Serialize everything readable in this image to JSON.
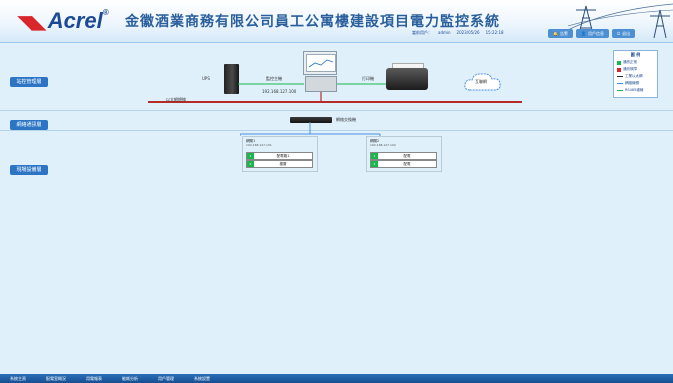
{
  "header": {
    "logo_text": "Acrel",
    "logo_mark": "◥◣",
    "logo_reg": "®",
    "title": "金徽酒業商務有限公司員工公寓樓建設項目電力監控系統",
    "info": [
      "當前用戶：",
      "admin",
      "2023/05/26",
      "15:22:18"
    ],
    "buttons": [
      {
        "label": "告警",
        "icon": "bell-icon"
      },
      {
        "label": "用戶信息",
        "icon": "user-icon"
      },
      {
        "label": "退出",
        "icon": "power-icon"
      }
    ]
  },
  "sidebar": {
    "items": [
      {
        "label": "站控管理層"
      },
      {
        "label": "網絡通訊層"
      },
      {
        "label": "現場設備層"
      }
    ]
  },
  "topology": {
    "server_label": "UPS",
    "bus_label": "以太網總線",
    "pc_label_1": "監控主機",
    "pc_label_2": "192.168.127.100",
    "printer_label": "打印機",
    "cloud_label": "互聯網",
    "switch_label": "網絡交換機"
  },
  "legend": {
    "title": "圖 例",
    "items": [
      {
        "label": "通訊正常",
        "color": "#18b84a",
        "kind": "box"
      },
      {
        "label": "通訊故障",
        "color": "#d8262a",
        "kind": "box"
      },
      {
        "label": "工業以太網",
        "color": "#2b2b2b",
        "kind": "line"
      },
      {
        "label": "網絡線纜",
        "color": "#4a8fe0",
        "kind": "line"
      },
      {
        "label": "RS485總線",
        "color": "#18b84a",
        "kind": "line"
      }
    ]
  },
  "panels": [
    {
      "name": "網關1",
      "ip": "192.168.127.101",
      "rows": [
        {
          "ind": "1",
          "name": "配電箱1"
        },
        {
          "ind": "2",
          "name": "樓層"
        }
      ]
    },
    {
      "name": "網關2",
      "ip": "192.168.127.102",
      "rows": [
        {
          "ind": "1",
          "name": "配電"
        },
        {
          "ind": "2",
          "name": "配電"
        }
      ]
    }
  ],
  "bottom_tabs": [
    "系統主頁",
    "配電室概況",
    "用電報表",
    "能耗分析",
    "用戶管理",
    "系統設置"
  ],
  "colors": {
    "accent": "#2c75c4",
    "alarm": "#d8262a",
    "ok": "#18b84a",
    "bus": "#b62c28"
  }
}
